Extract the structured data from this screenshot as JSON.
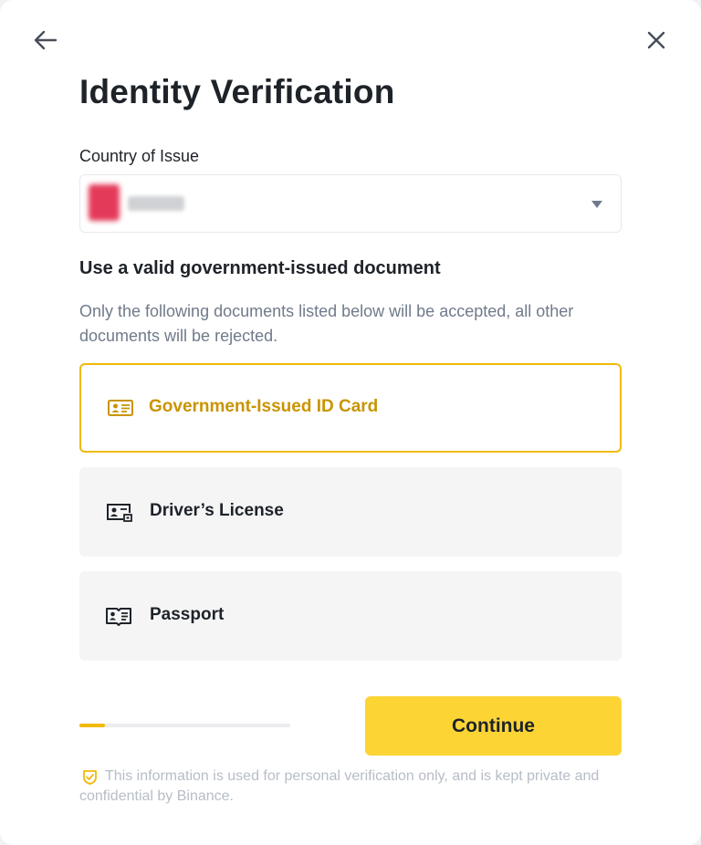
{
  "header": {
    "back_icon": "arrow-left-icon",
    "close_icon": "close-icon",
    "title": "Identity Verification"
  },
  "country": {
    "label": "Country of Issue",
    "value": "",
    "flag_icon": "country-flag-icon",
    "dropdown_icon": "caret-down-icon"
  },
  "documents": {
    "heading": "Use a valid government-issued document",
    "description": "Only the following documents listed below will be accepted, all other documents will be rejected.",
    "options": [
      {
        "label": "Government-Issued ID Card",
        "icon": "id-card-icon",
        "selected": true
      },
      {
        "label": "Driver’s License",
        "icon": "drivers-license-icon",
        "selected": false
      },
      {
        "label": "Passport",
        "icon": "passport-icon",
        "selected": false
      }
    ]
  },
  "progress": {
    "value": 0.12
  },
  "footer": {
    "continue_label": "Continue",
    "privacy_icon": "shield-check-icon",
    "privacy_text": "This information is used for personal verification only, and is kept private and confidential by Binance."
  },
  "colors": {
    "accent": "#F0B90B",
    "accent_text": "#C99400",
    "button": "#FCD535",
    "text_primary": "#1E2329",
    "text_secondary": "#707A8A",
    "text_muted": "#B7BDC6",
    "option_bg": "#F5F5F6"
  }
}
